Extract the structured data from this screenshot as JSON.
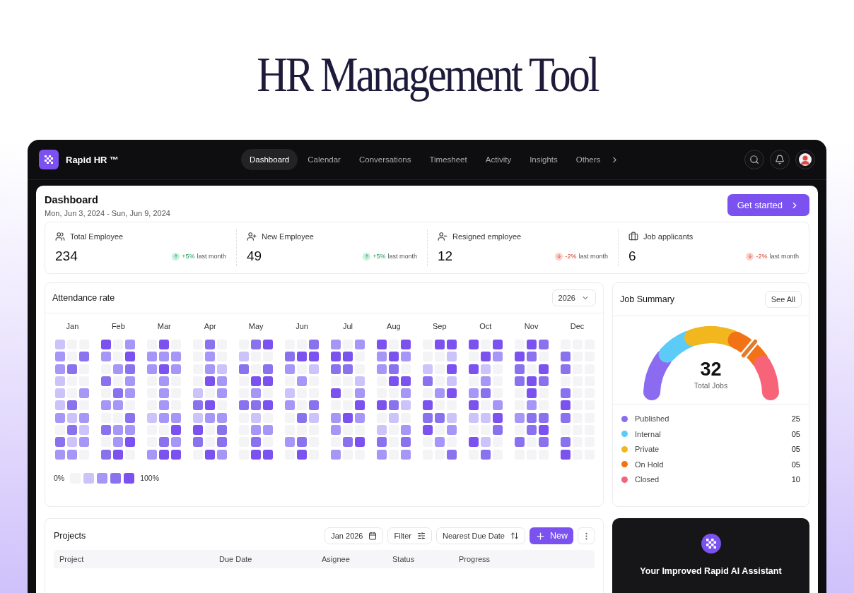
{
  "headline": "HR Management Tool",
  "app": {
    "brand": "Rapid HR ™",
    "nav": [
      {
        "label": "Dashboard",
        "selected": true
      },
      {
        "label": "Calendar",
        "selected": false
      },
      {
        "label": "Conversations",
        "selected": false
      },
      {
        "label": "Timesheet",
        "selected": false
      },
      {
        "label": "Activity",
        "selected": false
      },
      {
        "label": "Insights",
        "selected": false
      },
      {
        "label": "Others",
        "selected": false
      }
    ]
  },
  "page": {
    "title": "Dashboard",
    "date_range": "Mon, Jun 3, 2024 - Sun, Jun 9, 2024",
    "cta": "Get started"
  },
  "stats": [
    {
      "kind": "users",
      "label": "Total Employee",
      "value": "234",
      "rising": true,
      "change": "+5%",
      "period": "last month"
    },
    {
      "kind": "user-plus",
      "label": "New Employee",
      "value": "49",
      "rising": true,
      "change": "+5%",
      "period": "last month"
    },
    {
      "kind": "user-minus",
      "label": "Resigned employee",
      "value": "12",
      "rising": false,
      "change": "-2%",
      "period": "last month"
    },
    {
      "kind": "briefcase",
      "label": "Job applicants",
      "value": "6",
      "rising": false,
      "change": "-2%",
      "period": "last month"
    }
  ],
  "attendance": {
    "title": "Attendance rate",
    "year": "2026",
    "legend": {
      "min": "0%",
      "max": "100%"
    },
    "months": [
      {
        "label": "Jan",
        "cells": [
          {
            "color": "#cdc3fb"
          },
          {
            "color": "#f4f4f6"
          },
          {
            "color": "#f4f4f6"
          },
          {
            "color": "#a696f7"
          },
          {
            "color": "#f4f4f6"
          },
          {
            "color": "#8a72ef"
          },
          {
            "color": "#a696f7"
          },
          {
            "color": "#8a72ef"
          },
          {
            "color": "#f4f4f6"
          },
          {
            "color": "#cdc3fb"
          },
          {
            "color": "#f4f4f6"
          },
          {
            "color": "#f4f4f6"
          },
          {
            "color": "#cdc3fb"
          },
          {
            "color": "#f4f4f6"
          },
          {
            "color": "#a696f7"
          },
          {
            "color": "#cdc3fb"
          },
          {
            "color": "#8a72ef"
          },
          {
            "color": "#f4f4f6"
          },
          {
            "color": "#a696f7"
          },
          {
            "color": "#cdc3fb"
          },
          {
            "color": "#a696f7"
          },
          {
            "color": "#f4f4f6"
          },
          {
            "color": "#8a72ef"
          },
          {
            "color": "#cdc3fb"
          },
          {
            "color": "#8a72ef"
          },
          {
            "color": "#cdc3fb"
          },
          {
            "color": "#a696f7"
          },
          {
            "color": "#a696f7"
          },
          {
            "color": "#a696f7"
          },
          {
            "color": "#f4f4f6"
          }
        ]
      },
      {
        "label": "Feb",
        "cells": [
          {
            "color": "#7b52f0"
          },
          {
            "color": "#f4f4f6"
          },
          {
            "color": "#a696f7"
          },
          {
            "color": "#a696f7"
          },
          {
            "color": "#f4f4f6"
          },
          {
            "color": "#7b52f0"
          },
          {
            "color": "#f4f4f6"
          },
          {
            "color": "#a696f7"
          },
          {
            "color": "#8a72ef"
          },
          {
            "color": "#8a72ef"
          },
          {
            "color": "#f4f4f6"
          },
          {
            "color": "#a696f7"
          },
          {
            "color": "#f4f4f6"
          },
          {
            "color": "#8a72ef"
          },
          {
            "color": "#a696f7"
          },
          {
            "color": "#a696f7"
          },
          {
            "color": "#a696f7"
          },
          {
            "color": "#f4f4f6"
          },
          {
            "color": "#f4f4f6"
          },
          {
            "color": "#f4f4f6"
          },
          {
            "color": "#8a72ef"
          },
          {
            "color": "#8a72ef"
          },
          {
            "color": "#a696f7"
          },
          {
            "color": "#a696f7"
          },
          {
            "color": "#f4f4f6"
          },
          {
            "color": "#a696f7"
          },
          {
            "color": "#7b52f0"
          },
          {
            "color": "#8a72ef"
          },
          {
            "color": "#7b52f0"
          },
          {
            "color": "#f4f4f6"
          }
        ]
      },
      {
        "label": "Mar",
        "cells": [
          {
            "color": "#f4f4f6"
          },
          {
            "color": "#7b52f0"
          },
          {
            "color": "#f4f4f6"
          },
          {
            "color": "#a696f7"
          },
          {
            "color": "#a696f7"
          },
          {
            "color": "#a696f7"
          },
          {
            "color": "#a696f7"
          },
          {
            "color": "#7b52f0"
          },
          {
            "color": "#a696f7"
          },
          {
            "color": "#f4f4f6"
          },
          {
            "color": "#a696f7"
          },
          {
            "color": "#f4f4f6"
          },
          {
            "color": "#f4f4f6"
          },
          {
            "color": "#a696f7"
          },
          {
            "color": "#f4f4f6"
          },
          {
            "color": "#f4f4f6"
          },
          {
            "color": "#a696f7"
          },
          {
            "color": "#f4f4f6"
          },
          {
            "color": "#cdc3fb"
          },
          {
            "color": "#a696f7"
          },
          {
            "color": "#a696f7"
          },
          {
            "color": "#f4f4f6"
          },
          {
            "color": "#f4f4f6"
          },
          {
            "color": "#7b52f0"
          },
          {
            "color": "#f4f4f6"
          },
          {
            "color": "#8a72ef"
          },
          {
            "color": "#a696f7"
          },
          {
            "color": "#a696f7"
          },
          {
            "color": "#7b52f0"
          },
          {
            "color": "#7b52f0"
          }
        ]
      },
      {
        "label": "Apr",
        "cells": [
          {
            "color": "#f4f4f6"
          },
          {
            "color": "#8a72ef"
          },
          {
            "color": "#f4f4f6"
          },
          {
            "color": "#f4f4f6"
          },
          {
            "color": "#a696f7"
          },
          {
            "color": "#f4f4f6"
          },
          {
            "color": "#f4f4f6"
          },
          {
            "color": "#a696f7"
          },
          {
            "color": "#cdc3fb"
          },
          {
            "color": "#f4f4f6"
          },
          {
            "color": "#7b52f0"
          },
          {
            "color": "#a696f7"
          },
          {
            "color": "#cdc3fb"
          },
          {
            "color": "#f4f4f6"
          },
          {
            "color": "#a696f7"
          },
          {
            "color": "#8a72ef"
          },
          {
            "color": "#7b52f0"
          },
          {
            "color": "#f4f4f6"
          },
          {
            "color": "#cdc3fb"
          },
          {
            "color": "#a696f7"
          },
          {
            "color": "#a696f7"
          },
          {
            "color": "#7b52f0"
          },
          {
            "color": "#f4f4f6"
          },
          {
            "color": "#8a72ef"
          },
          {
            "color": "#8a72ef"
          },
          {
            "color": "#f4f4f6"
          },
          {
            "color": "#8a72ef"
          },
          {
            "color": "#f4f4f6"
          },
          {
            "color": "#7b52f0"
          },
          {
            "color": "#a696f7"
          }
        ]
      },
      {
        "label": "May",
        "cells": [
          {
            "color": "#f4f4f6"
          },
          {
            "color": "#8a72ef"
          },
          {
            "color": "#7b52f0"
          },
          {
            "color": "#cdc3fb"
          },
          {
            "color": "#f4f4f6"
          },
          {
            "color": "#f4f4f6"
          },
          {
            "color": "#8a72ef"
          },
          {
            "color": "#f4f4f6"
          },
          {
            "color": "#8a72ef"
          },
          {
            "color": "#f4f4f6"
          },
          {
            "color": "#7b52f0"
          },
          {
            "color": "#7b52f0"
          },
          {
            "color": "#f4f4f6"
          },
          {
            "color": "#a696f7"
          },
          {
            "color": "#f4f4f6"
          },
          {
            "color": "#8a72ef"
          },
          {
            "color": "#8a72ef"
          },
          {
            "color": "#7b52f0"
          },
          {
            "color": "#f4f4f6"
          },
          {
            "color": "#cdc3fb"
          },
          {
            "color": "#f4f4f6"
          },
          {
            "color": "#f4f4f6"
          },
          {
            "color": "#a696f7"
          },
          {
            "color": "#a696f7"
          },
          {
            "color": "#f4f4f6"
          },
          {
            "color": "#8a72ef"
          },
          {
            "color": "#f4f4f6"
          },
          {
            "color": "#f4f4f6"
          },
          {
            "color": "#7b52f0"
          },
          {
            "color": "#7b52f0"
          }
        ]
      },
      {
        "label": "Jun",
        "cells": [
          {
            "color": "#f4f4f6"
          },
          {
            "color": "#f4f4f6"
          },
          {
            "color": "#8a72ef"
          },
          {
            "color": "#8a72ef"
          },
          {
            "color": "#7b52f0"
          },
          {
            "color": "#7b52f0"
          },
          {
            "color": "#a696f7"
          },
          {
            "color": "#f4f4f6"
          },
          {
            "color": "#cdc3fb"
          },
          {
            "color": "#f4f4f6"
          },
          {
            "color": "#a696f7"
          },
          {
            "color": "#f4f4f6"
          },
          {
            "color": "#cdc3fb"
          },
          {
            "color": "#f4f4f6"
          },
          {
            "color": "#f4f4f6"
          },
          {
            "color": "#a696f7"
          },
          {
            "color": "#f4f4f6"
          },
          {
            "color": "#8a72ef"
          },
          {
            "color": "#f4f4f6"
          },
          {
            "color": "#8a72ef"
          },
          {
            "color": "#cdc3fb"
          },
          {
            "color": "#f4f4f6"
          },
          {
            "color": "#f4f4f6"
          },
          {
            "color": "#f4f4f6"
          },
          {
            "color": "#a696f7"
          },
          {
            "color": "#8a72ef"
          },
          {
            "color": "#f4f4f6"
          },
          {
            "color": "#f4f4f6"
          },
          {
            "color": "#7b52f0"
          },
          {
            "color": "#f4f4f6"
          }
        ]
      },
      {
        "label": "Jul",
        "cells": [
          {
            "color": "#a696f7"
          },
          {
            "color": "#f4f4f6"
          },
          {
            "color": "#a696f7"
          },
          {
            "color": "#7b52f0"
          },
          {
            "color": "#7b52f0"
          },
          {
            "color": "#f4f4f6"
          },
          {
            "color": "#8a72ef"
          },
          {
            "color": "#8a72ef"
          },
          {
            "color": "#f4f4f6"
          },
          {
            "color": "#f4f4f6"
          },
          {
            "color": "#f4f4f6"
          },
          {
            "color": "#cdc3fb"
          },
          {
            "color": "#7b52f0"
          },
          {
            "color": "#f4f4f6"
          },
          {
            "color": "#a696f7"
          },
          {
            "color": "#f4f4f6"
          },
          {
            "color": "#f4f4f6"
          },
          {
            "color": "#7b52f0"
          },
          {
            "color": "#a696f7"
          },
          {
            "color": "#7b52f0"
          },
          {
            "color": "#a696f7"
          },
          {
            "color": "#a696f7"
          },
          {
            "color": "#f4f4f6"
          },
          {
            "color": "#f4f4f6"
          },
          {
            "color": "#f4f4f6"
          },
          {
            "color": "#8a72ef"
          },
          {
            "color": "#7b52f0"
          },
          {
            "color": "#a696f7"
          },
          {
            "color": "#f4f4f6"
          },
          {
            "color": "#f4f4f6"
          }
        ]
      },
      {
        "label": "Aug",
        "cells": [
          {
            "color": "#7b52f0"
          },
          {
            "color": "#f4f4f6"
          },
          {
            "color": "#7b52f0"
          },
          {
            "color": "#a696f7"
          },
          {
            "color": "#7b52f0"
          },
          {
            "color": "#a696f7"
          },
          {
            "color": "#a696f7"
          },
          {
            "color": "#8a72ef"
          },
          {
            "color": "#f4f4f6"
          },
          {
            "color": "#f4f4f6"
          },
          {
            "color": "#7b52f0"
          },
          {
            "color": "#7b52f0"
          },
          {
            "color": "#f4f4f6"
          },
          {
            "color": "#f4f4f6"
          },
          {
            "color": "#a696f7"
          },
          {
            "color": "#7b52f0"
          },
          {
            "color": "#8a72ef"
          },
          {
            "color": "#cdc3fb"
          },
          {
            "color": "#f4f4f6"
          },
          {
            "color": "#cdc3fb"
          },
          {
            "color": "#f4f4f6"
          },
          {
            "color": "#cdc3fb"
          },
          {
            "color": "#f4f4f6"
          },
          {
            "color": "#a696f7"
          },
          {
            "color": "#8a72ef"
          },
          {
            "color": "#f4f4f6"
          },
          {
            "color": "#8a72ef"
          },
          {
            "color": "#a696f7"
          },
          {
            "color": "#f4f4f6"
          },
          {
            "color": "#a696f7"
          }
        ]
      },
      {
        "label": "Sep",
        "cells": [
          {
            "color": "#f4f4f6"
          },
          {
            "color": "#7b52f0"
          },
          {
            "color": "#7b52f0"
          },
          {
            "color": "#f4f4f6"
          },
          {
            "color": "#f4f4f6"
          },
          {
            "color": "#cdc3fb"
          },
          {
            "color": "#cdc3fb"
          },
          {
            "color": "#f4f4f6"
          },
          {
            "color": "#7b52f0"
          },
          {
            "color": "#8a72ef"
          },
          {
            "color": "#f4f4f6"
          },
          {
            "color": "#cdc3fb"
          },
          {
            "color": "#f4f4f6"
          },
          {
            "color": "#a696f7"
          },
          {
            "color": "#7b52f0"
          },
          {
            "color": "#7b52f0"
          },
          {
            "color": "#f4f4f6"
          },
          {
            "color": "#f4f4f6"
          },
          {
            "color": "#8a72ef"
          },
          {
            "color": "#8a72ef"
          },
          {
            "color": "#cdc3fb"
          },
          {
            "color": "#7b52f0"
          },
          {
            "color": "#f4f4f6"
          },
          {
            "color": "#a696f7"
          },
          {
            "color": "#f4f4f6"
          },
          {
            "color": "#a696f7"
          },
          {
            "color": "#f4f4f6"
          },
          {
            "color": "#f4f4f6"
          },
          {
            "color": "#f4f4f6"
          },
          {
            "color": "#8a72ef"
          }
        ]
      },
      {
        "label": "Oct",
        "cells": [
          {
            "color": "#7b52f0"
          },
          {
            "color": "#f4f4f6"
          },
          {
            "color": "#7b52f0"
          },
          {
            "color": "#f4f4f6"
          },
          {
            "color": "#7b52f0"
          },
          {
            "color": "#a696f7"
          },
          {
            "color": "#7b52f0"
          },
          {
            "color": "#cdc3fb"
          },
          {
            "color": "#f4f4f6"
          },
          {
            "color": "#f4f4f6"
          },
          {
            "color": "#a696f7"
          },
          {
            "color": "#f4f4f6"
          },
          {
            "color": "#a696f7"
          },
          {
            "color": "#8a72ef"
          },
          {
            "color": "#f4f4f6"
          },
          {
            "color": "#7b52f0"
          },
          {
            "color": "#f4f4f6"
          },
          {
            "color": "#a696f7"
          },
          {
            "color": "#cdc3fb"
          },
          {
            "color": "#cdc3fb"
          },
          {
            "color": "#7b52f0"
          },
          {
            "color": "#f4f4f6"
          },
          {
            "color": "#f4f4f6"
          },
          {
            "color": "#8a72ef"
          },
          {
            "color": "#7b52f0"
          },
          {
            "color": "#cdc3fb"
          },
          {
            "color": "#f4f4f6"
          },
          {
            "color": "#f4f4f6"
          },
          {
            "color": "#8a72ef"
          },
          {
            "color": "#f4f4f6"
          }
        ]
      },
      {
        "label": "Nov",
        "cells": [
          {
            "color": "#f4f4f6"
          },
          {
            "color": "#7b52f0"
          },
          {
            "color": "#8a72ef"
          },
          {
            "color": "#7b52f0"
          },
          {
            "color": "#8a72ef"
          },
          {
            "color": "#f4f4f6"
          },
          {
            "color": "#8a72ef"
          },
          {
            "color": "#f4f4f6"
          },
          {
            "color": "#7b52f0"
          },
          {
            "color": "#8a72ef"
          },
          {
            "color": "#7b52f0"
          },
          {
            "color": "#8a72ef"
          },
          {
            "color": "#f4f4f6"
          },
          {
            "color": "#7b52f0"
          },
          {
            "color": "#f4f4f6"
          },
          {
            "color": "#f4f4f6"
          },
          {
            "color": "#a696f7"
          },
          {
            "color": "#f4f4f6"
          },
          {
            "color": "#a696f7"
          },
          {
            "color": "#8a72ef"
          },
          {
            "color": "#8a72ef"
          },
          {
            "color": "#f4f4f6"
          },
          {
            "color": "#8a72ef"
          },
          {
            "color": "#7b52f0"
          },
          {
            "color": "#8a72ef"
          },
          {
            "color": "#f4f4f6"
          },
          {
            "color": "#8a72ef"
          },
          {
            "color": "#f4f4f6"
          },
          {
            "color": "#f4f4f6"
          },
          {
            "color": "#f4f4f6"
          }
        ]
      },
      {
        "label": "Dec",
        "cells": [
          {
            "color": "#f4f4f6"
          },
          {
            "color": "#f4f4f6"
          },
          {
            "color": "#f4f4f6"
          },
          {
            "color": "#8a72ef"
          },
          {
            "color": "#f4f4f6"
          },
          {
            "color": "#f4f4f6"
          },
          {
            "color": "#8a72ef"
          },
          {
            "color": "#f4f4f6"
          },
          {
            "color": "#f4f4f6"
          },
          {
            "color": "#f4f4f6"
          },
          {
            "color": "#f4f4f6"
          },
          {
            "color": "#f4f4f6"
          },
          {
            "color": "#8a72ef"
          },
          {
            "color": "#f4f4f6"
          },
          {
            "color": "#f4f4f6"
          },
          {
            "color": "#7b52f0"
          },
          {
            "color": "#f4f4f6"
          },
          {
            "color": "#f4f4f6"
          },
          {
            "color": "#8a72ef"
          },
          {
            "color": "#f4f4f6"
          },
          {
            "color": "#f4f4f6"
          },
          {
            "color": "#f4f4f6"
          },
          {
            "color": "#f4f4f6"
          },
          {
            "color": "#f4f4f6"
          },
          {
            "color": "#8a72ef"
          },
          {
            "color": "#f4f4f6"
          },
          {
            "color": "#f4f4f6"
          },
          {
            "color": "#7b52f0"
          },
          {
            "color": "#f4f4f6"
          },
          {
            "color": "#f4f4f6"
          }
        ]
      }
    ]
  },
  "job_summary": {
    "title": "Job Summary",
    "action": "See All",
    "total": "32",
    "total_label": "Total Jobs",
    "items": [
      {
        "label": "Published",
        "count": "25",
        "color": "#8b6cf0"
      },
      {
        "label": "Internal",
        "count": "05",
        "color": "#5ccbf7"
      },
      {
        "label": "Private",
        "count": "05",
        "color": "#f2b71f"
      },
      {
        "label": "On Hold",
        "count": "05",
        "color": "#f27316"
      },
      {
        "label": "Closed",
        "count": "10",
        "color": "#f7647a"
      }
    ]
  },
  "projects": {
    "title": "Projects",
    "month": "Jan 2026",
    "filter": "Filter",
    "sort": "Nearest Due Date",
    "new": "New",
    "columns": [
      "Project",
      "Due Date",
      "Asignee",
      "Status",
      "Progress"
    ]
  },
  "assistant": {
    "title": "Your Improved Rapid AI Assistant"
  }
}
